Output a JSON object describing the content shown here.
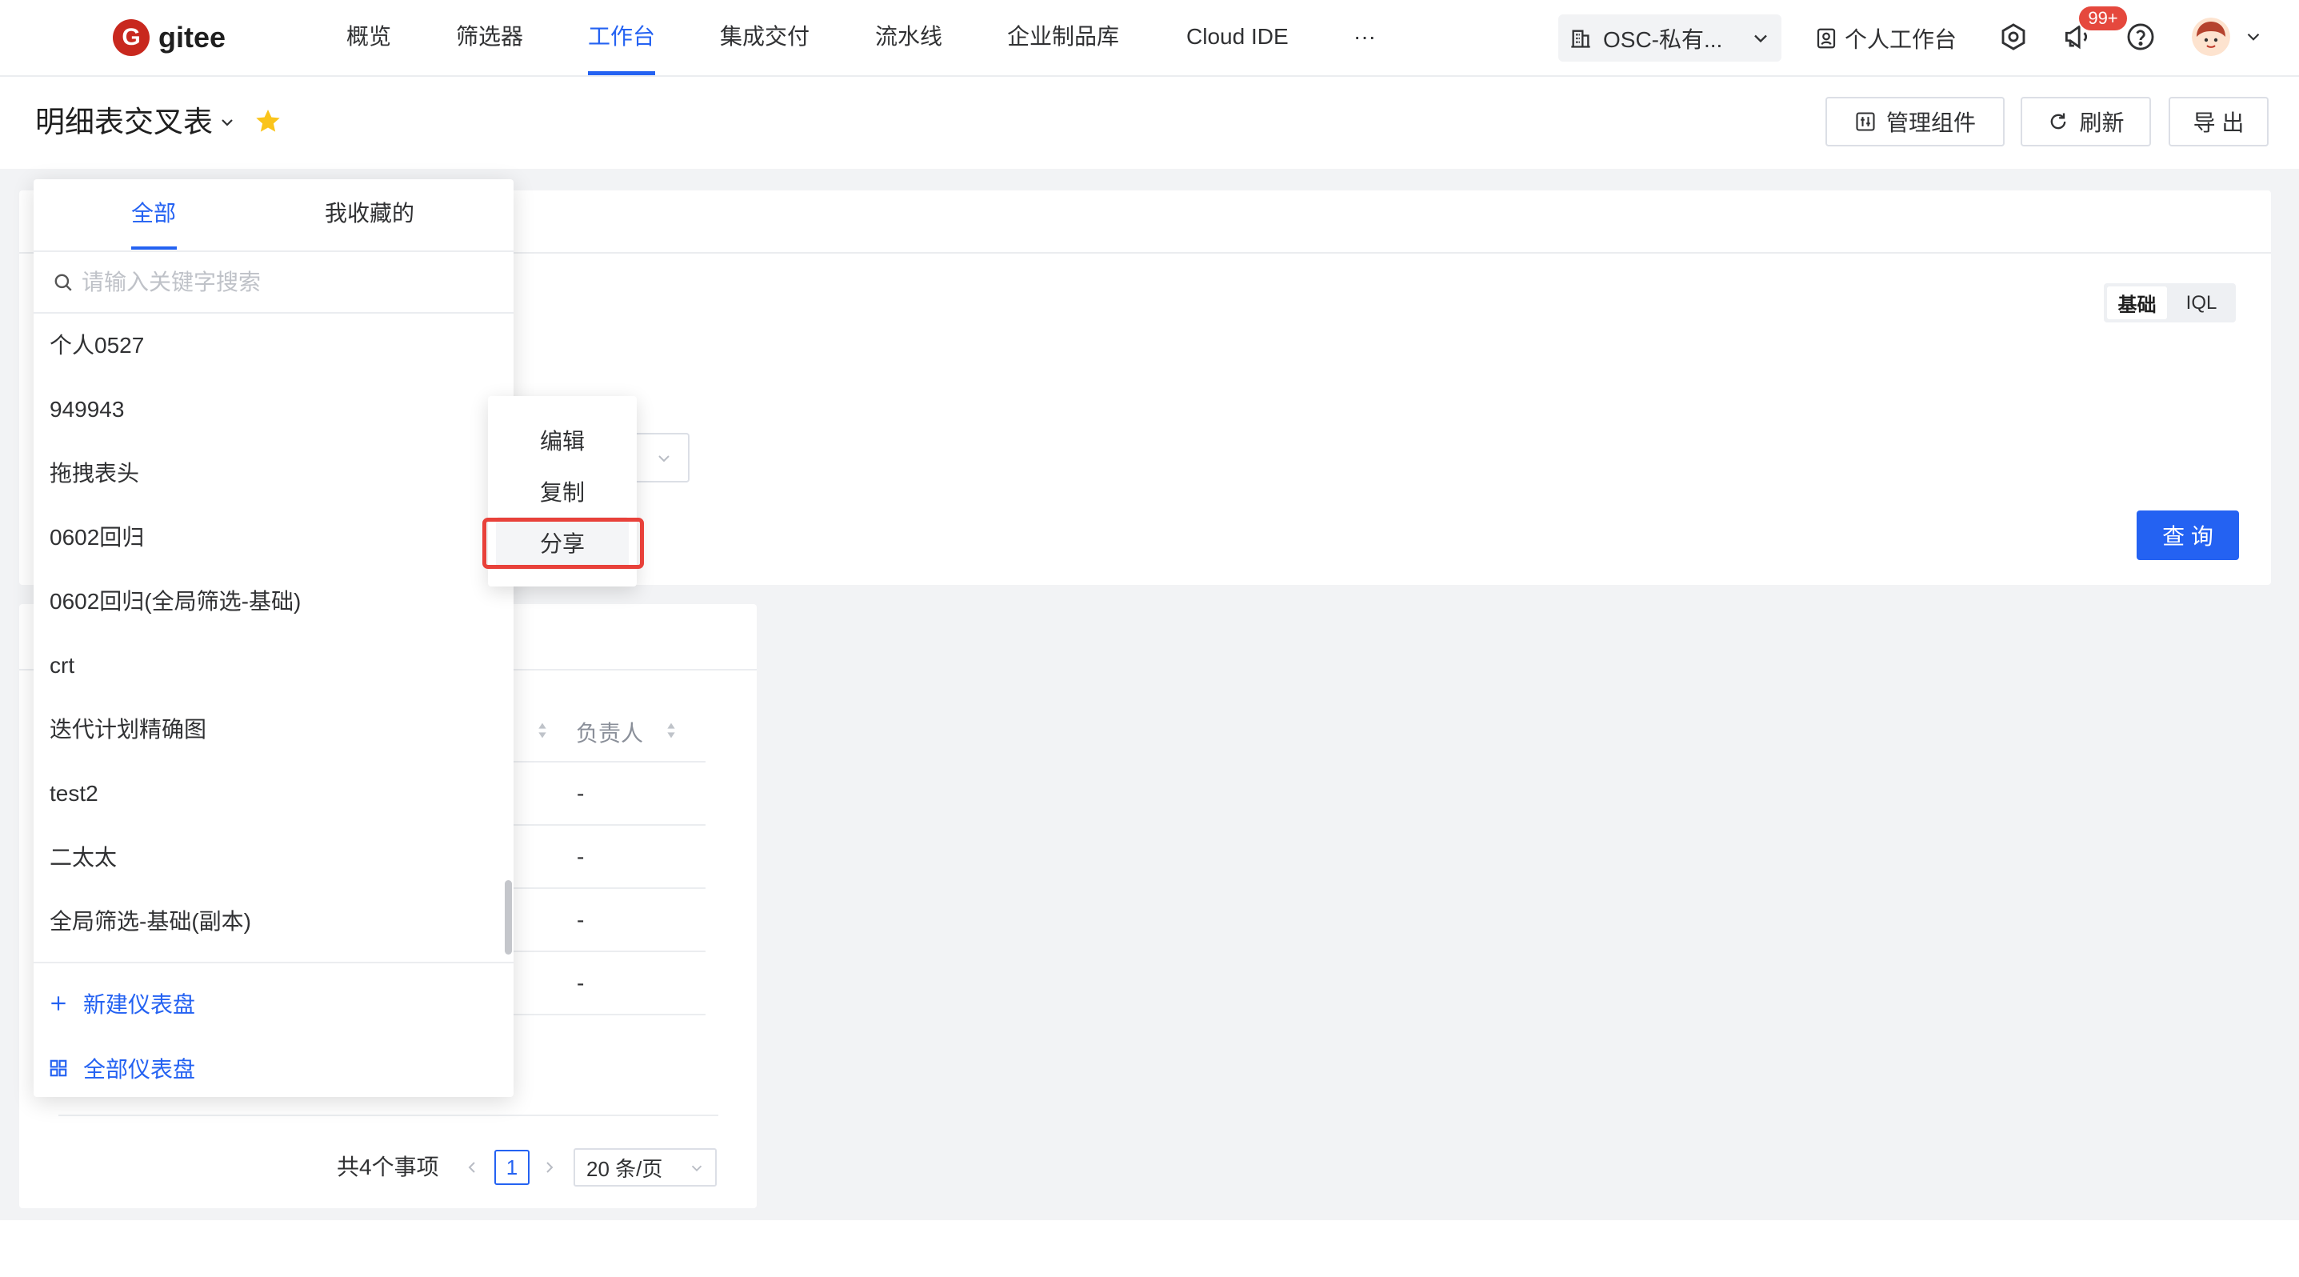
{
  "brand": {
    "logo_letter": "G",
    "name": "gitee"
  },
  "nav": {
    "items": [
      {
        "label": "概览",
        "active": false
      },
      {
        "label": "筛选器",
        "active": false
      },
      {
        "label": "工作台",
        "active": true
      },
      {
        "label": "集成交付",
        "active": false
      },
      {
        "label": "流水线",
        "active": false
      },
      {
        "label": "企业制品库",
        "active": false
      },
      {
        "label": "Cloud IDE",
        "active": false
      }
    ],
    "more_label": "···"
  },
  "topbar": {
    "org_label": "OSC-私有...",
    "workbench_label": "个人工作台",
    "notification_badge": "99+",
    "icons": [
      "building-icon",
      "workbench-icon",
      "gear-icon",
      "megaphone-icon",
      "help-icon",
      "avatar",
      "chevron-down-icon"
    ]
  },
  "page": {
    "title": "明细表交叉表",
    "favorited": true,
    "actions": {
      "manage": "管理组件",
      "refresh": "刷新",
      "export": "导 出"
    }
  },
  "filter_panel": {
    "mode_tabs": [
      {
        "label": "基础",
        "active": true
      },
      {
        "label": "IQL",
        "active": false
      }
    ],
    "query_button": "查 询"
  },
  "table_card": {
    "columns": [
      {
        "label": "负责人",
        "sortable": true
      }
    ],
    "rows": [
      {
        "owner": "-"
      },
      {
        "owner": "-"
      },
      {
        "owner": "-"
      },
      {
        "owner": "-"
      }
    ],
    "pagination": {
      "total": "共4个事项",
      "current_page": "1",
      "page_size": "20 条/页"
    }
  },
  "dashboard_dropdown": {
    "tabs": [
      {
        "label": "全部",
        "active": true
      },
      {
        "label": "我收藏的",
        "active": false
      }
    ],
    "search_placeholder": "请输入关键字搜索",
    "items": [
      "个人0527",
      "949943",
      "拖拽表头",
      "0602回归",
      "0602回归(全局筛选-基础)",
      "crt",
      "迭代计划精确图",
      "test2",
      "二太太",
      "全局筛选-基础(副本)"
    ],
    "footer": {
      "new_label": "新建仪表盘",
      "all_label": "全部仪表盘"
    }
  },
  "context_menu": {
    "items": [
      {
        "label": "编辑",
        "hovered": false
      },
      {
        "label": "复制",
        "hovered": false
      },
      {
        "label": "分享",
        "hovered": true,
        "annotated": true
      }
    ]
  },
  "colors": {
    "accent": "#2462f2",
    "badge": "#e5483d",
    "star": "#fac41b",
    "annotation": "#e8413a",
    "logo": "#c8281e",
    "page_bg": "#f2f3f5"
  }
}
